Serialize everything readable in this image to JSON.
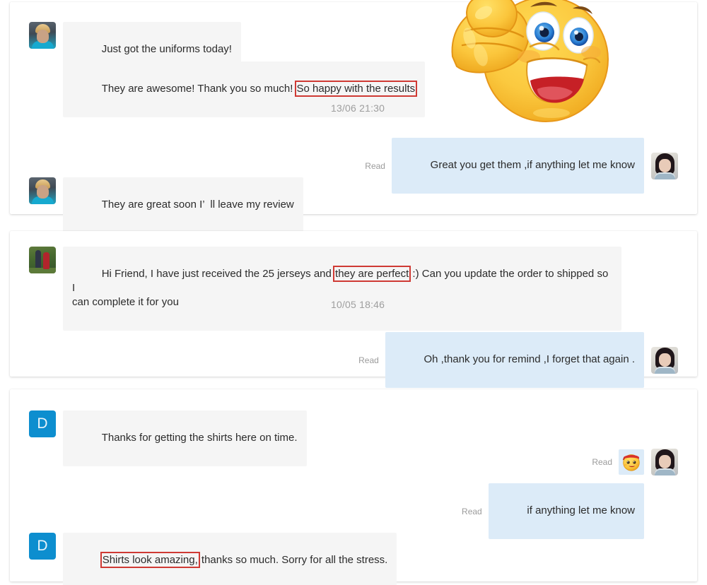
{
  "page": {
    "title": "Customer feedback message threads",
    "background_color": "#ffffff"
  },
  "style": {
    "incoming_bubble_color": "#f5f5f5",
    "outgoing_bubble_color": "#dcebf8",
    "highlight_border_color": "#cf3a34",
    "avatar_initial_color": "#0d8ecf",
    "timestamp_color": "#9e9e9e",
    "read_label_color": "#9b9b9b"
  },
  "conversations": [
    {
      "id": "conversation-1",
      "messages": [
        {
          "id": "c1-m1",
          "direction": "incoming",
          "avatar": "woman-blonde-selfie",
          "text": "Just got the uniforms today!"
        },
        {
          "id": "c1-m2",
          "direction": "incoming",
          "avatar": null,
          "text_before": "They are awesome! Thank you so much! ",
          "text_highlight": "So happy with the results",
          "text_after": ""
        },
        {
          "id": "c1-sticker",
          "direction": "incoming",
          "type": "sticker",
          "sticker_name": "thumbs-up-smiley-sticker"
        },
        {
          "id": "c1-time",
          "type": "timestamp",
          "text": "13/06 21:30"
        },
        {
          "id": "c1-m3",
          "direction": "outgoing",
          "avatar": "woman-dark-hair",
          "read_label": "Read",
          "text": "Great you get them ,if anything let me know"
        },
        {
          "id": "c1-m4",
          "direction": "incoming",
          "avatar": "woman-blonde-selfie",
          "text": "They are great soon I’  ll leave my review"
        }
      ]
    },
    {
      "id": "conversation-2",
      "messages": [
        {
          "id": "c2-m1",
          "direction": "incoming",
          "avatar": "couple-outdoors",
          "text_before": "Hi Friend, I have just received the 25 jerseys and ",
          "text_highlight": "they are perfect",
          "text_after": " :) Can you update the order to shipped so I\ncan complete it for you"
        },
        {
          "id": "c2-time",
          "type": "timestamp",
          "text": "10/05 18:46"
        },
        {
          "id": "c2-m2",
          "direction": "outgoing",
          "avatar": "woman-dark-hair",
          "read_label": "Read",
          "text": "Oh ,thank you for remind ,I forget that again ."
        }
      ]
    },
    {
      "id": "conversation-3",
      "messages": [
        {
          "id": "c3-m1",
          "direction": "incoming",
          "avatar": "initial-D",
          "avatar_initial": "D",
          "text": "Thanks for getting the shirts here on time."
        },
        {
          "id": "c3-m2",
          "direction": "outgoing",
          "avatar": "woman-dark-hair",
          "read_label": "Read",
          "type": "emoji-reaction",
          "emoji": "🤩",
          "emoji_name": "star-struck-emoji-sticker"
        },
        {
          "id": "c3-m3",
          "direction": "outgoing",
          "avatar": null,
          "read_label": "Read",
          "text": "if anything let me know"
        },
        {
          "id": "c3-m4",
          "direction": "incoming",
          "avatar": "initial-D",
          "avatar_initial": "D",
          "text_before": "",
          "text_highlight": "Shirts look amazing,",
          "text_after": " thanks so much. Sorry for all the stress."
        }
      ]
    }
  ]
}
